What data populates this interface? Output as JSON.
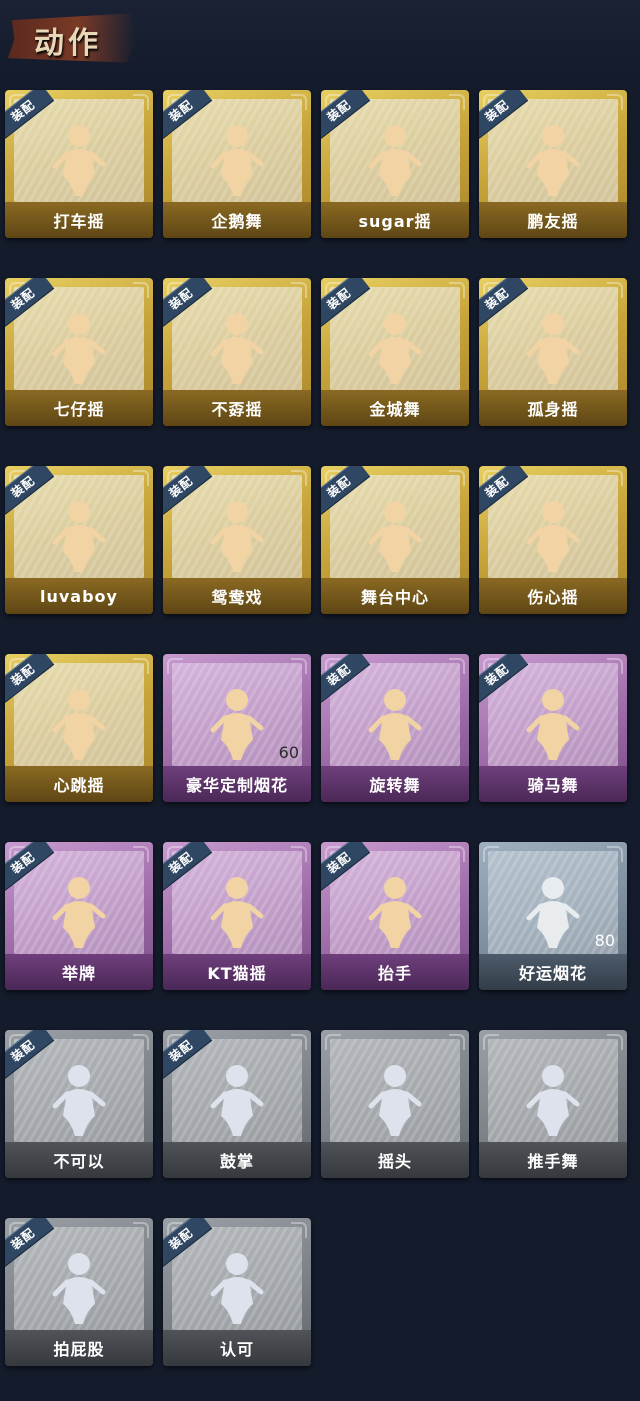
{
  "header": {
    "title": "动作"
  },
  "equip_badge_label": "装配",
  "colors": {
    "gold": "#c7a53a",
    "purple": "#9c6aa6",
    "blue": "#7d8d9d",
    "gray": "#7b8187",
    "badge": "#2f4763",
    "background": "#141b2b"
  },
  "cards": [
    {
      "label": "打车摇",
      "rarity": "gold",
      "equipped": true,
      "icon": "dance-figure-icon"
    },
    {
      "label": "企鹅舞",
      "rarity": "gold",
      "equipped": true,
      "icon": "dance-figure-icon"
    },
    {
      "label": "sugar摇",
      "rarity": "gold",
      "equipped": true,
      "icon": "dance-figure-icon"
    },
    {
      "label": "鹏友摇",
      "rarity": "gold",
      "equipped": true,
      "icon": "dance-figure-icon"
    },
    {
      "label": "七仔摇",
      "rarity": "gold",
      "equipped": true,
      "icon": "dance-figure-icon"
    },
    {
      "label": "不孬摇",
      "rarity": "gold",
      "equipped": true,
      "icon": "dance-figure-icon"
    },
    {
      "label": "金城舞",
      "rarity": "gold",
      "equipped": true,
      "icon": "dance-figure-icon"
    },
    {
      "label": "孤身摇",
      "rarity": "gold",
      "equipped": true,
      "icon": "dance-figure-icon"
    },
    {
      "label": "luvaboy",
      "rarity": "gold",
      "equipped": true,
      "icon": "dance-figure-icon"
    },
    {
      "label": "鸳鸯戏",
      "rarity": "gold",
      "equipped": true,
      "icon": "dance-figure-icon"
    },
    {
      "label": "舞台中心",
      "rarity": "gold",
      "equipped": true,
      "icon": "dance-figure-icon"
    },
    {
      "label": "伤心摇",
      "rarity": "gold",
      "equipped": true,
      "icon": "heart-hands-icon"
    },
    {
      "label": "心跳摇",
      "rarity": "gold",
      "equipped": true,
      "icon": "dance-figure-icon"
    },
    {
      "label": "豪华定制烟花",
      "rarity": "purple",
      "equipped": false,
      "icon": "fireworks-icon",
      "count": "60"
    },
    {
      "label": "旋转舞",
      "rarity": "purple",
      "equipped": true,
      "icon": "spin-figure-icon"
    },
    {
      "label": "骑马舞",
      "rarity": "purple",
      "equipped": true,
      "icon": "dance-figure-icon"
    },
    {
      "label": "举牌",
      "rarity": "purple",
      "equipped": true,
      "icon": "sign-figure-icon"
    },
    {
      "label": "KT猫摇",
      "rarity": "purple",
      "equipped": true,
      "icon": "dance-figure-icon"
    },
    {
      "label": "抬手",
      "rarity": "purple",
      "equipped": true,
      "icon": "raise-hand-icon"
    },
    {
      "label": "好运烟花",
      "rarity": "blue",
      "equipped": false,
      "icon": "firework-can-icon",
      "count": "80"
    },
    {
      "label": "不可以",
      "rarity": "gray",
      "equipped": true,
      "icon": "finger-wag-icon"
    },
    {
      "label": "鼓掌",
      "rarity": "gray",
      "equipped": true,
      "icon": "clap-icon"
    },
    {
      "label": "摇头",
      "rarity": "gray",
      "equipped": false,
      "icon": "shake-head-icon"
    },
    {
      "label": "推手舞",
      "rarity": "gray",
      "equipped": false,
      "icon": "push-hands-icon"
    },
    {
      "label": "拍屁股",
      "rarity": "gray",
      "equipped": true,
      "icon": "pat-figure-icon"
    },
    {
      "label": "认可",
      "rarity": "gray",
      "equipped": true,
      "icon": "thumbs-up-icon"
    }
  ]
}
